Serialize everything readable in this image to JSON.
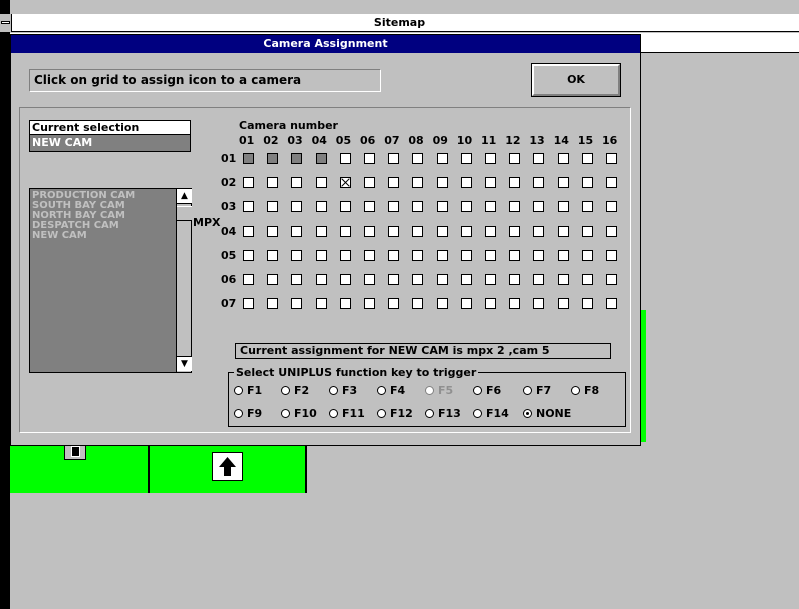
{
  "background_window": {
    "title": "Sitemap"
  },
  "dialog": {
    "title": "Camera Assignment",
    "instruction": "Click on grid to assign icon to a camera",
    "ok_label": "OK",
    "current_selection_label": "Current selection",
    "current_selection_value": "NEW CAM",
    "camera_list": [
      "PRODUCTION CAM",
      "SOUTH BAY CAM",
      "NORTH BAY CAM",
      "DESPATCH CAM",
      "NEW CAM"
    ],
    "mpx_label": "MPX",
    "camera_number_label": "Camera number",
    "columns": [
      "01",
      "02",
      "03",
      "04",
      "05",
      "06",
      "07",
      "08",
      "09",
      "10",
      "11",
      "12",
      "13",
      "14",
      "15",
      "16"
    ],
    "rows": [
      "01",
      "02",
      "03",
      "04",
      "05",
      "06",
      "07"
    ],
    "disabled_cells": [
      [
        0,
        0
      ],
      [
        0,
        1
      ],
      [
        0,
        2
      ],
      [
        0,
        3
      ]
    ],
    "checked_cells": [
      [
        1,
        4
      ]
    ],
    "assignment_text": "Current assignment for NEW CAM is mpx 2 ,cam 5",
    "function_key_group_label": "Select UNIPLUS function key to trigger",
    "function_keys": [
      {
        "label": "F1",
        "selected": false,
        "disabled": false
      },
      {
        "label": "F2",
        "selected": false,
        "disabled": false
      },
      {
        "label": "F3",
        "selected": false,
        "disabled": false
      },
      {
        "label": "F4",
        "selected": false,
        "disabled": false
      },
      {
        "label": "F5",
        "selected": false,
        "disabled": true
      },
      {
        "label": "F6",
        "selected": false,
        "disabled": false
      },
      {
        "label": "F7",
        "selected": false,
        "disabled": false
      },
      {
        "label": "F8",
        "selected": false,
        "disabled": false
      },
      {
        "label": "F9",
        "selected": false,
        "disabled": false
      },
      {
        "label": "F10",
        "selected": false,
        "disabled": false
      },
      {
        "label": "F11",
        "selected": false,
        "disabled": false
      },
      {
        "label": "F12",
        "selected": false,
        "disabled": false
      },
      {
        "label": "F13",
        "selected": false,
        "disabled": false
      },
      {
        "label": "F14",
        "selected": false,
        "disabled": false
      },
      {
        "label": "NONE",
        "selected": true,
        "disabled": false
      }
    ]
  },
  "colors": {
    "title_bar": "#000080",
    "face": "#c0c0c0",
    "list_bg": "#808080",
    "list_text": "#c0c0c0",
    "green": "#00ff00"
  }
}
